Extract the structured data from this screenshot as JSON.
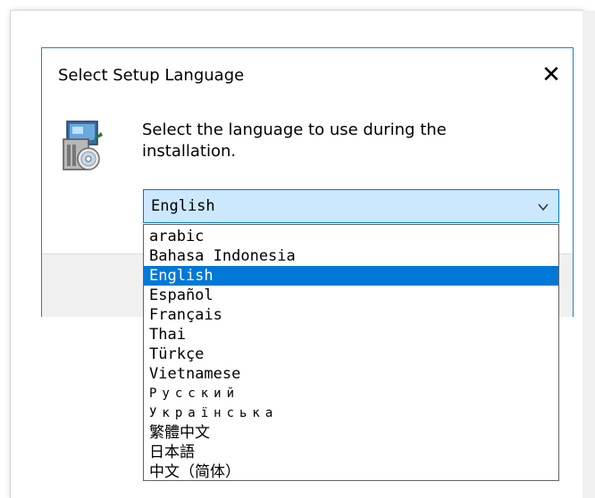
{
  "dialog": {
    "title": "Select Setup Language",
    "close_symbol": "✕",
    "icon": "setup-installer-icon",
    "prompt": "Select the language to use during the installation."
  },
  "language_select": {
    "selected_value": "English",
    "options": [
      "arabic",
      "Bahasa Indonesia",
      "English",
      "Español",
      "Français",
      "Thai",
      "Türkçe",
      "Vietnamese",
      "Русский",
      "Українська",
      "繁體中文",
      "日本語",
      "中文（简体）"
    ]
  },
  "colors": {
    "accent": "#0078d7",
    "combo_bg": "#cce8ff",
    "footer_bg": "#f0f0f0"
  }
}
